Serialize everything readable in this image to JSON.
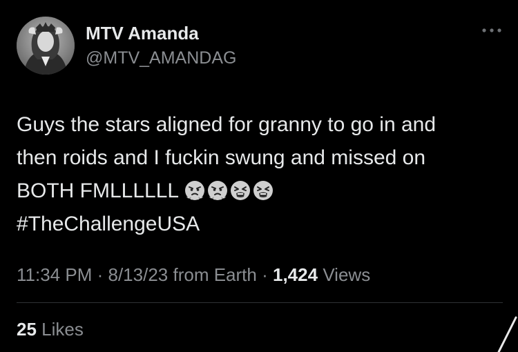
{
  "author": {
    "display_name": "MTV Amanda",
    "handle": "@MTV_AMANDAG"
  },
  "more_icon": "more-horizontal-icon",
  "tweet": {
    "lines": [
      "Guys the stars aligned for granny to go in and",
      "then roids and I fuckin swung and missed on",
      "BOTH FMLLLLLL"
    ],
    "emojis": [
      "face-with-steam-from-nose",
      "face-with-steam-from-nose",
      "tired-face",
      "tired-face"
    ],
    "hashtag": "#TheChallengeUSA"
  },
  "meta": {
    "time": "11:34 PM",
    "separator": "·",
    "date": "8/13/23",
    "source": "from Earth",
    "views_count": "1,424",
    "views_label": "Views"
  },
  "stats": {
    "likes_count": "25",
    "likes_label": "Likes"
  },
  "colors": {
    "background": "#000000",
    "primary_text": "#e7e9ea",
    "secondary_text": "#8b8e92",
    "divider": "#2f3336"
  }
}
